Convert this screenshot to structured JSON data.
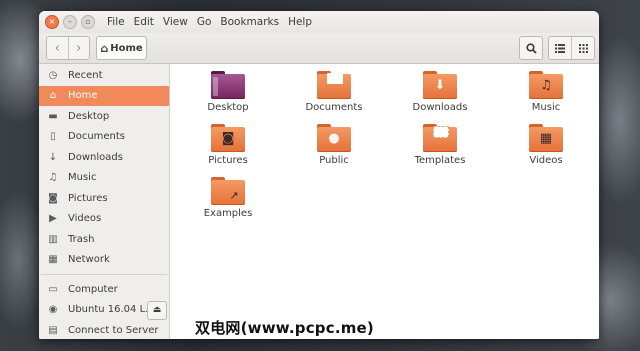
{
  "menu": [
    "File",
    "Edit",
    "View",
    "Go",
    "Bookmarks",
    "Help"
  ],
  "toolbar": {
    "back_icon": "chevron-left-icon",
    "forward_icon": "chevron-right-icon",
    "path_label": "Home",
    "search_icon": "search-icon",
    "list_view_icon": "list-view-icon",
    "grid_view_icon": "grid-view-icon"
  },
  "sidebar": {
    "places": [
      {
        "label": "Recent",
        "icon": "clock-icon"
      },
      {
        "label": "Home",
        "icon": "home-icon",
        "active": true
      },
      {
        "label": "Desktop",
        "icon": "desktop-icon"
      },
      {
        "label": "Documents",
        "icon": "document-icon"
      },
      {
        "label": "Downloads",
        "icon": "download-icon"
      },
      {
        "label": "Music",
        "icon": "music-icon"
      },
      {
        "label": "Pictures",
        "icon": "camera-icon"
      },
      {
        "label": "Videos",
        "icon": "video-icon"
      },
      {
        "label": "Trash",
        "icon": "trash-icon"
      }
    ],
    "network": {
      "label": "Network",
      "icon": "network-icon"
    },
    "devices": [
      {
        "label": "Computer",
        "icon": "computer-icon"
      },
      {
        "label": "Ubuntu 16.04 L...",
        "icon": "disc-icon"
      },
      {
        "label": "Connect to Server",
        "icon": "server-icon"
      }
    ]
  },
  "files": [
    {
      "label": "Desktop",
      "icon": "desktop-folder-icon"
    },
    {
      "label": "Documents",
      "icon": "documents-folder-icon"
    },
    {
      "label": "Downloads",
      "icon": "downloads-folder-icon"
    },
    {
      "label": "Music",
      "icon": "music-folder-icon"
    },
    {
      "label": "Pictures",
      "icon": "pictures-folder-icon"
    },
    {
      "label": "Public",
      "icon": "public-folder-icon"
    },
    {
      "label": "Templates",
      "icon": "templates-folder-icon"
    },
    {
      "label": "Videos",
      "icon": "videos-folder-icon"
    },
    {
      "label": "Examples",
      "icon": "examples-folder-icon"
    }
  ],
  "watermark": "双电网(www.pcpc.me)",
  "colors": {
    "accent": "#f18a5a",
    "folder": "#e5713a",
    "desktop_folder": "#77215e"
  }
}
